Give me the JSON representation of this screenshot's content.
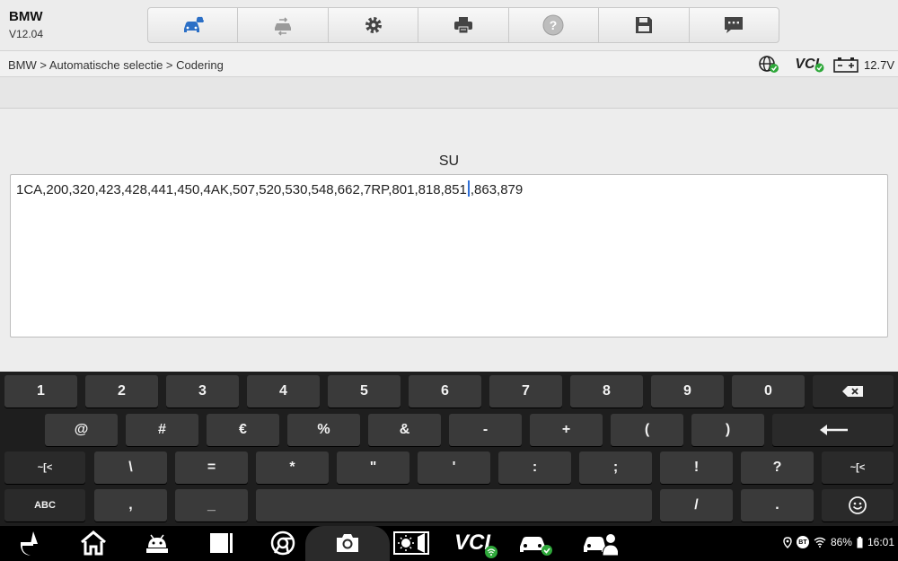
{
  "app": {
    "name": "BMW",
    "version": "V12.04"
  },
  "toolbar": {
    "buttons": [
      {
        "icon": "vehicle-cloud-icon",
        "active": true
      },
      {
        "icon": "vehicle-swap-icon",
        "active": false
      },
      {
        "icon": "gear-icon",
        "active": false
      },
      {
        "icon": "printer-icon",
        "active": false
      },
      {
        "icon": "help-icon",
        "active": false
      },
      {
        "icon": "save-icon",
        "active": false
      },
      {
        "icon": "message-icon",
        "active": false
      }
    ],
    "accent": "#2b6fc6"
  },
  "breadcrumb": "BMW > Automatische selectie > Codering",
  "status": {
    "vci_label": "VCI",
    "voltage": "12.7V"
  },
  "field": {
    "label": "SU",
    "value_before_caret": "1CA,200,320,423,428,441,450,4AK,507,520,530,548,662,7RP,801,818,851",
    "value_after_caret": ",863,879"
  },
  "keyboard": {
    "row1": [
      "1",
      "2",
      "3",
      "4",
      "5",
      "6",
      "7",
      "8",
      "9",
      "0"
    ],
    "row2": [
      "@",
      "#",
      "€",
      "%",
      "&",
      "-",
      "+",
      "(",
      ")"
    ],
    "row3_left": "~[<",
    "row3": [
      "\\",
      "=",
      "*",
      "\"",
      "'",
      ":",
      ";",
      "!",
      "?"
    ],
    "row3_right": "~[<",
    "row4_left": "ABC",
    "row4": [
      ",",
      "_"
    ],
    "row4_right": [
      "/",
      "."
    ],
    "backspace_icon": "backspace-icon",
    "enter_icon": "enter-icon",
    "emoji_icon": "emoji-icon"
  },
  "system": {
    "battery": "86%",
    "time": "16:01",
    "bt_label": "BT"
  }
}
